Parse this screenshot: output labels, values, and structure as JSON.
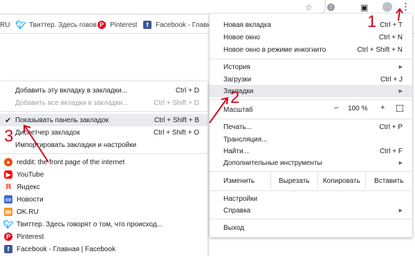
{
  "bookmarks_bar": {
    "items": [
      {
        "label": "RU",
        "icon": "none"
      },
      {
        "label": "Твиттер. Здесь говов",
        "icon": "twitter-icon"
      },
      {
        "label": "Pinterest",
        "icon": "pinterest-icon"
      },
      {
        "label": "Facebook - Главна",
        "icon": "facebook-icon"
      }
    ]
  },
  "main_menu": {
    "new_tab": {
      "label": "Новая вкладка",
      "shortcut": "Ctrl + T"
    },
    "new_window": {
      "label": "Новое окно",
      "shortcut": "Ctrl + N"
    },
    "incognito": {
      "label": "Новое окно в режиме инкогнито",
      "shortcut": "Ctrl + Shift + N"
    },
    "history": {
      "label": "История"
    },
    "downloads": {
      "label": "Загрузки",
      "shortcut": "Ctrl + J"
    },
    "bookmarks": {
      "label": "Закладки"
    },
    "zoom": {
      "label": "Масштаб",
      "minus": "–",
      "value": "100 %",
      "plus": "+"
    },
    "print": {
      "label": "Печать...",
      "shortcut": "Ctrl + P"
    },
    "cast": {
      "label": "Трансляция..."
    },
    "find": {
      "label": "Найти...",
      "shortcut": "Ctrl + F"
    },
    "more_tools": {
      "label": "Дополнительные инструменты"
    },
    "edit": {
      "label": "Изменить",
      "cut": "Вырезать",
      "copy": "Копировать",
      "paste": "Вставить"
    },
    "settings": {
      "label": "Настройки"
    },
    "help": {
      "label": "Справка"
    },
    "exit": {
      "label": "Выход"
    }
  },
  "bookmarks_menu": {
    "add_tab": {
      "label": "Добавить эту вкладку в закладки...",
      "shortcut": "Ctrl + D"
    },
    "add_all": {
      "label": "Добавить все вкладки в закладки...",
      "shortcut": "Ctrl + Shift + D"
    },
    "show_bar": {
      "label": "Показывать панель закладок",
      "shortcut": "Ctrl + Shift + B",
      "checked": true
    },
    "manager": {
      "label": "Диспетчер закладок",
      "shortcut": "Ctrl + Shift + O"
    },
    "import": {
      "label": "Импортировать закладки и настройки"
    },
    "bookmarks": [
      {
        "label": "reddit: the front page of the internet",
        "icon": "reddit-icon"
      },
      {
        "label": "YouTube",
        "icon": "youtube-icon"
      },
      {
        "label": "Яндекс",
        "icon": "yandex-icon"
      },
      {
        "label": "Новости",
        "icon": "news-icon"
      },
      {
        "label": "OK.RU",
        "icon": "odnoklassniki-icon"
      },
      {
        "label": "Твиттер. Здесь говорят о том, что происход...",
        "icon": "twitter-icon"
      },
      {
        "label": "Pinterest",
        "icon": "pinterest-icon"
      },
      {
        "label": "Facebook - Главная | Facebook",
        "icon": "facebook-icon"
      }
    ]
  },
  "annotations": {
    "step1": "1",
    "step2": "2",
    "step3": "3"
  },
  "colors": {
    "annotation": "#d0021b",
    "highlight": "#e8eaed"
  }
}
